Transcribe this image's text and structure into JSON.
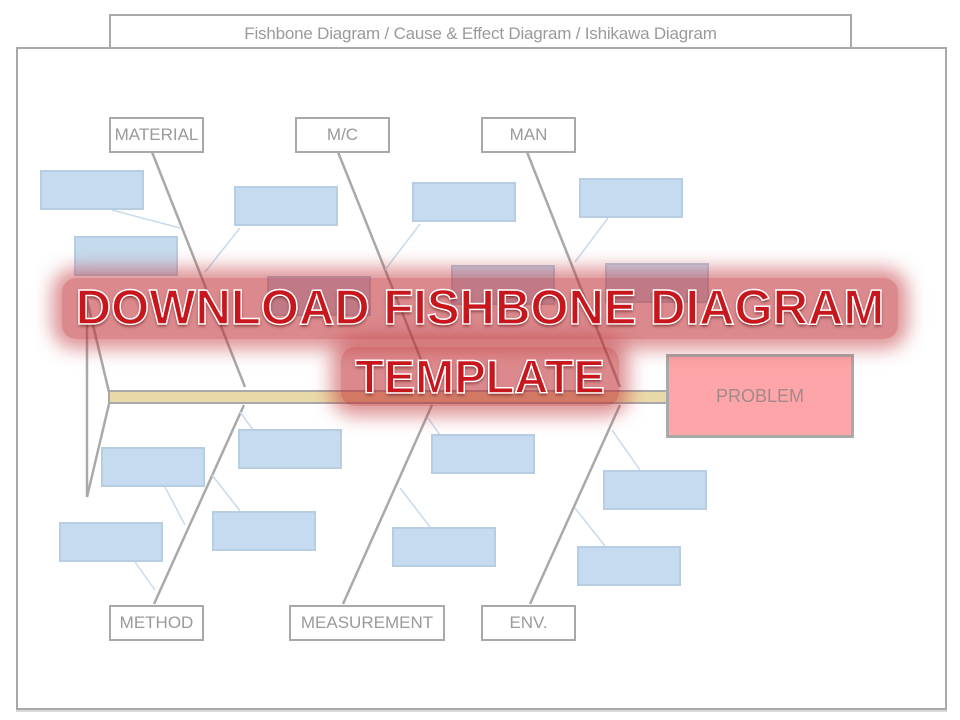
{
  "header": {
    "title": "Fishbone Diagram / Cause & Effect Diagram / Ishikawa Diagram"
  },
  "diagram": {
    "categories_top": [
      "MATERIAL",
      "M/C",
      "MAN"
    ],
    "categories_bottom": [
      "METHOD",
      "MEASUREMENT",
      "ENV."
    ],
    "problem_label": "PROBLEM",
    "cause_box_count": 16,
    "colors": {
      "spine": "#ead9a8",
      "bone_line": "#a9a9a9",
      "cause_fill": "#c6dbef",
      "problem_fill": "#fda5a8",
      "banner_text": "#c8161d"
    }
  },
  "banner": {
    "line1": "DOWNLOAD FISHBONE DIAGRAM",
    "line2": "TEMPLATE"
  }
}
